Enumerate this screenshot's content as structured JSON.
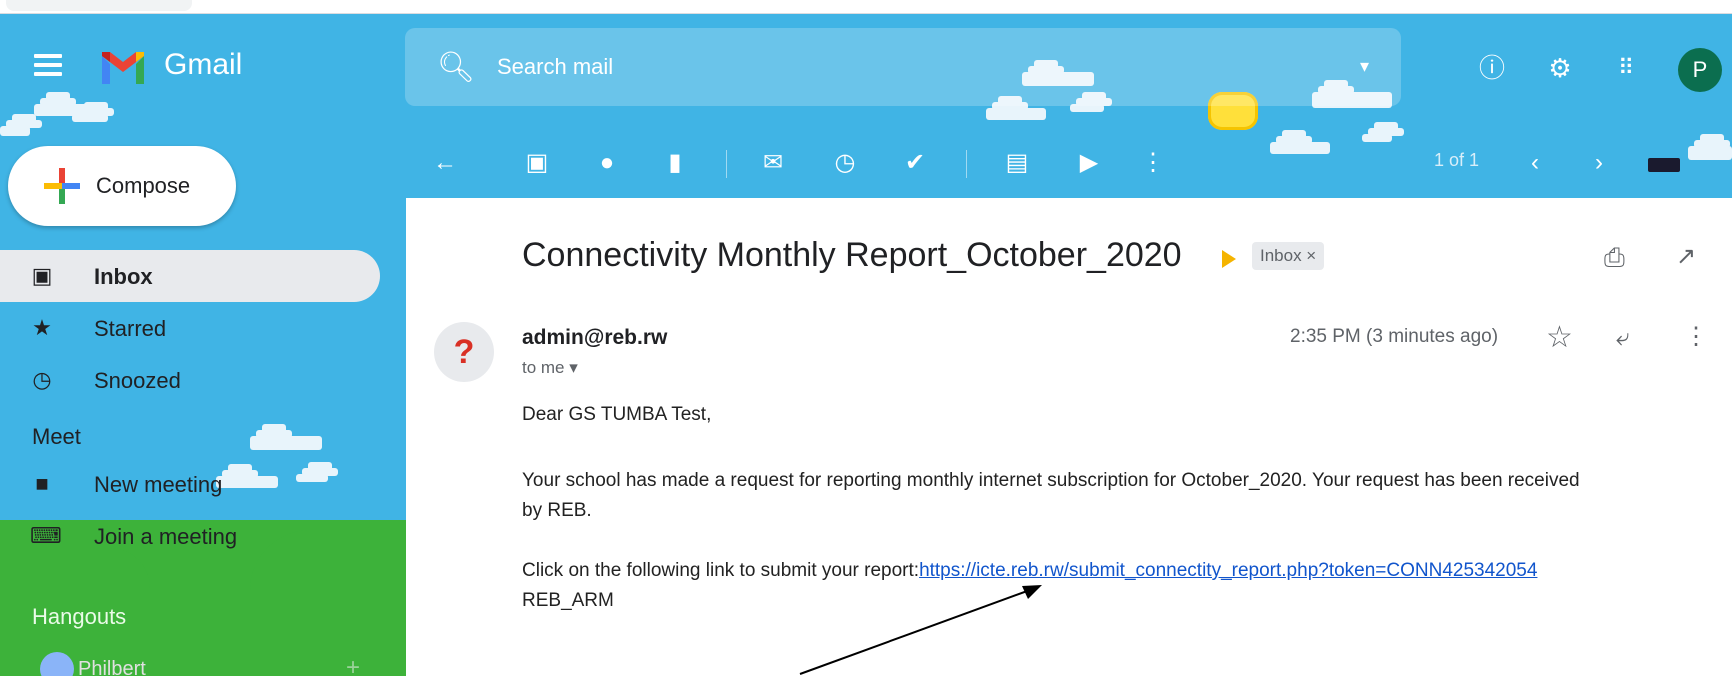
{
  "header": {
    "app_name": "Gmail",
    "search_placeholder": "Search mail",
    "avatar_letter": "P"
  },
  "compose": {
    "label": "Compose"
  },
  "sidebar": {
    "items": [
      {
        "label": "Inbox",
        "icon": "inbox-icon",
        "active": true
      },
      {
        "label": "Starred",
        "icon": "star-icon"
      },
      {
        "label": "Snoozed",
        "icon": "clock-icon"
      }
    ],
    "meet": {
      "heading": "Meet",
      "items": [
        {
          "label": "New meeting",
          "icon": "video-icon"
        },
        {
          "label": "Join a meeting",
          "icon": "keyboard-icon"
        }
      ]
    },
    "hangouts": {
      "heading": "Hangouts",
      "user": "Philbert"
    }
  },
  "toolbar": {
    "pager": "1 of 1",
    "icons": [
      "back-icon",
      "archive-icon",
      "report-spam-icon",
      "delete-icon",
      "mark-unread-icon",
      "snooze-icon",
      "add-task-icon",
      "move-to-icon",
      "label-icon",
      "more-icon"
    ]
  },
  "message": {
    "subject": "Connectivity Monthly Report_October_2020",
    "label_chip": "Inbox ×",
    "sender": "admin@reb.rw",
    "to": "to me ▾",
    "timestamp": "2:35 PM (3 minutes ago)",
    "sender_avatar": "?",
    "greeting": "Dear GS TUMBA Test,",
    "para1_line1": "Your school has made a request for reporting monthly internet subscription for October_2020. Your request has been received",
    "para1_line2": "by REB.",
    "para2_prefix": "Click on the following link to submit your report:",
    "para2_link": "https://icte.reb.rw/submit_connectity_report.php?token=CONN425342054",
    "signature": "REB_ARM"
  },
  "colors": {
    "sky": "#40b4e5",
    "grass": "#3db23a",
    "link": "#1155cc",
    "avatar_bg": "#0b6e4f"
  }
}
